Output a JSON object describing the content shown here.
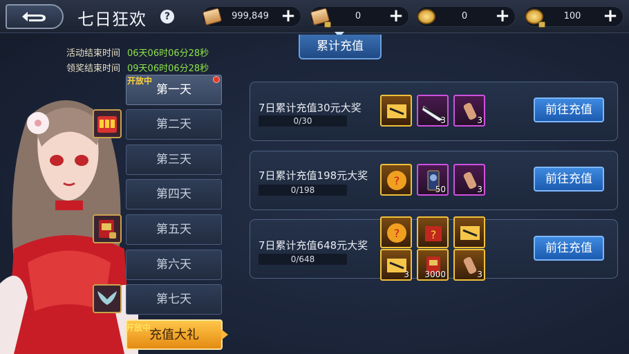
{
  "header": {
    "back_label": "⊃",
    "title": "七日狂欢",
    "help": "?",
    "resources": [
      {
        "icon": "scroll-icon",
        "value": "999,849"
      },
      {
        "icon": "locked-scroll-icon",
        "value": "0"
      },
      {
        "icon": "coin-icon",
        "value": "0"
      },
      {
        "icon": "locked-coin-icon",
        "value": "100"
      }
    ],
    "plus": "+"
  },
  "main_tab": "累计充值",
  "times": {
    "activity_label": "活动结束时间",
    "activity_value": "06天06时06分28秒",
    "claim_label": "领奖结束时间",
    "claim_value": "09天06时06分28秒"
  },
  "days": {
    "open_tag": "开放中",
    "items": [
      "第一天",
      "第二天",
      "第三天",
      "第四天",
      "第五天",
      "第六天",
      "第七天"
    ]
  },
  "recharge_gift": {
    "open_tag": "开放中",
    "label": "充值大礼"
  },
  "rewards": [
    {
      "title": "7日累计充值30元大奖",
      "progress": "0/30",
      "button": "前往充值",
      "items": [
        {
          "icon": "ticket-icon",
          "count": ""
        },
        {
          "icon": "blade-icon",
          "count": "3"
        },
        {
          "icon": "gauntlet-icon",
          "count": "3"
        }
      ]
    },
    {
      "title": "7日累计充值198元大奖",
      "progress": "0/198",
      "button": "前往充值",
      "items": [
        {
          "icon": "mystery-orb-icon",
          "count": ""
        },
        {
          "icon": "hero-card-icon",
          "count": "50"
        },
        {
          "icon": "gauntlet-icon",
          "count": "3"
        }
      ]
    },
    {
      "title": "7日累计充值648元大奖",
      "progress": "0/648",
      "button": "前往充值",
      "items": [
        {
          "icon": "mystery-orb-icon",
          "count": ""
        },
        {
          "icon": "mystery-chest-icon",
          "count": ""
        },
        {
          "icon": "ticket-icon",
          "count": ""
        },
        {
          "icon": "ticket-icon",
          "count": "3"
        },
        {
          "icon": "red-book-icon",
          "count": "3000"
        },
        {
          "icon": "gauntlet-icon",
          "count": "3"
        }
      ]
    }
  ],
  "colors": {
    "accent_blue": "#2f6fc4",
    "timer_green": "#8fe34a",
    "gold_border": "#f0c23a",
    "purple_border": "#d050e0",
    "open_tag_yellow": "#ffd23a"
  }
}
